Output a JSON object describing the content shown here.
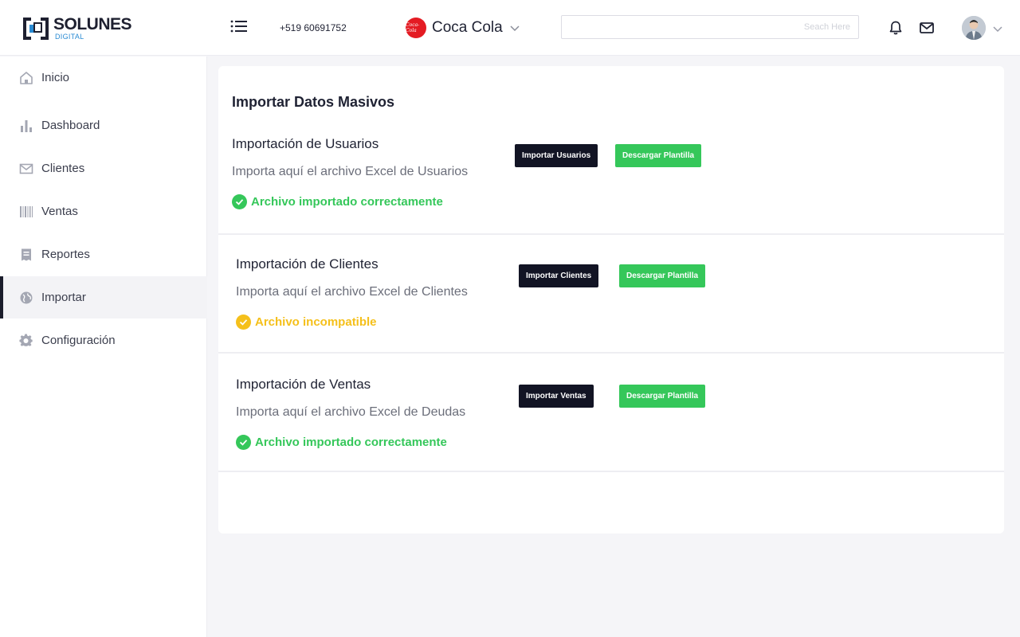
{
  "header": {
    "logo_text": "SOLUNES",
    "logo_sub": "DIGITAL",
    "phone": "+519 60691752",
    "brand_logo_text": "Coca-Cola",
    "brand_name": "Coca Cola",
    "search_placeholder": "Seach Here",
    "icons": {
      "menu": "list-menu-icon",
      "brand_dropdown": "chevron-down-icon",
      "notifications": "bell-icon",
      "messages": "mail-icon",
      "avatar_dropdown": "chevron-down-icon"
    }
  },
  "sidebar": {
    "items": [
      {
        "label": "Inicio",
        "icon": "home-icon",
        "active": false
      },
      {
        "label": "Dashboard",
        "icon": "bar-chart-icon",
        "active": false
      },
      {
        "label": "Clientes",
        "icon": "envelope-icon",
        "active": false
      },
      {
        "label": "Ventas",
        "icon": "barcode-icon",
        "active": false
      },
      {
        "label": "Reportes",
        "icon": "receipt-icon",
        "active": false
      },
      {
        "label": "Importar",
        "icon": "globe-icon",
        "active": true
      },
      {
        "label": "Configuración",
        "icon": "gear-icon",
        "active": false
      }
    ]
  },
  "main": {
    "title": "Importar Datos Masivos",
    "sections": [
      {
        "title": "Importación de Usuarios",
        "description": "Importa aquí el archivo Excel de Usuarios",
        "import_label": "Importar Usuarios",
        "download_label": "Descargar Plantilla",
        "status_text": "Archivo importado correctamente",
        "status": "success",
        "status_color": "#35c75a"
      },
      {
        "title": "Importación de Clientes",
        "description": "Importa aquí el archivo Excel de Clientes",
        "import_label": "Importar Clientes",
        "download_label": "Descargar Plantilla",
        "status_text": "Archivo incompatible",
        "status": "warning",
        "status_color": "#f5c01b"
      },
      {
        "title": "Importación de Ventas",
        "description": "Importa aquí el archivo Excel de Deudas",
        "import_label": "Importar Ventas",
        "download_label": "Descargar Plantilla",
        "status_text": "Archivo importado correctamente",
        "status": "success",
        "status_color": "#35c75a"
      }
    ]
  },
  "colors": {
    "accent_dark": "#121424",
    "success": "#35c75a",
    "warning": "#f5c01b",
    "brand_red": "#e41b23",
    "logo_blue": "#2a8bd3"
  }
}
